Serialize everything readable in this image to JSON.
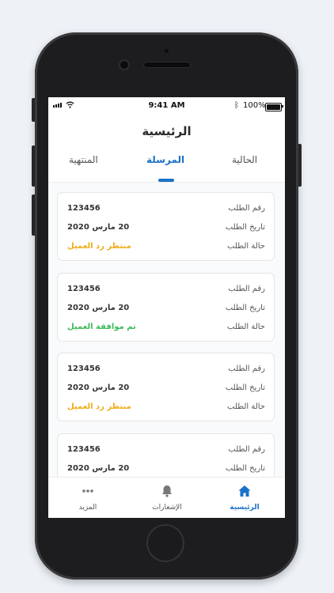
{
  "status_bar": {
    "time": "9:41 AM",
    "battery": "100%"
  },
  "header": {
    "title": "الرئيسية"
  },
  "tabs": [
    {
      "label": "المنتهية"
    },
    {
      "label": "المرسلة",
      "active": true
    },
    {
      "label": "الحالية"
    }
  ],
  "labels": {
    "order_number": "رقم الطلب",
    "order_date": "تاريخ الطلب",
    "order_status": "حالة الطلب"
  },
  "orders": [
    {
      "number": "123456",
      "date": "20 مارس 2020",
      "status": "منتظر رد العميل",
      "status_color": "#f0ad1c"
    },
    {
      "number": "123456",
      "date": "20 مارس 2020",
      "status": "تم موافقة العميل",
      "status_color": "#3dbb5a"
    },
    {
      "number": "123456",
      "date": "20 مارس 2020",
      "status": "منتظر رد العميل",
      "status_color": "#f0ad1c"
    },
    {
      "number": "123456",
      "date": "20 مارس 2020"
    }
  ],
  "bottom_nav": {
    "more": {
      "label": "المزيد",
      "icon": "more-dots-icon"
    },
    "notifications": {
      "label": "الإشعارات",
      "icon": "bell-icon"
    },
    "home": {
      "label": "الرئيسية",
      "icon": "home-icon",
      "active": true
    }
  },
  "colors": {
    "accent": "#1a72c8",
    "pending": "#f0ad1c",
    "approved": "#3dbb5a"
  }
}
